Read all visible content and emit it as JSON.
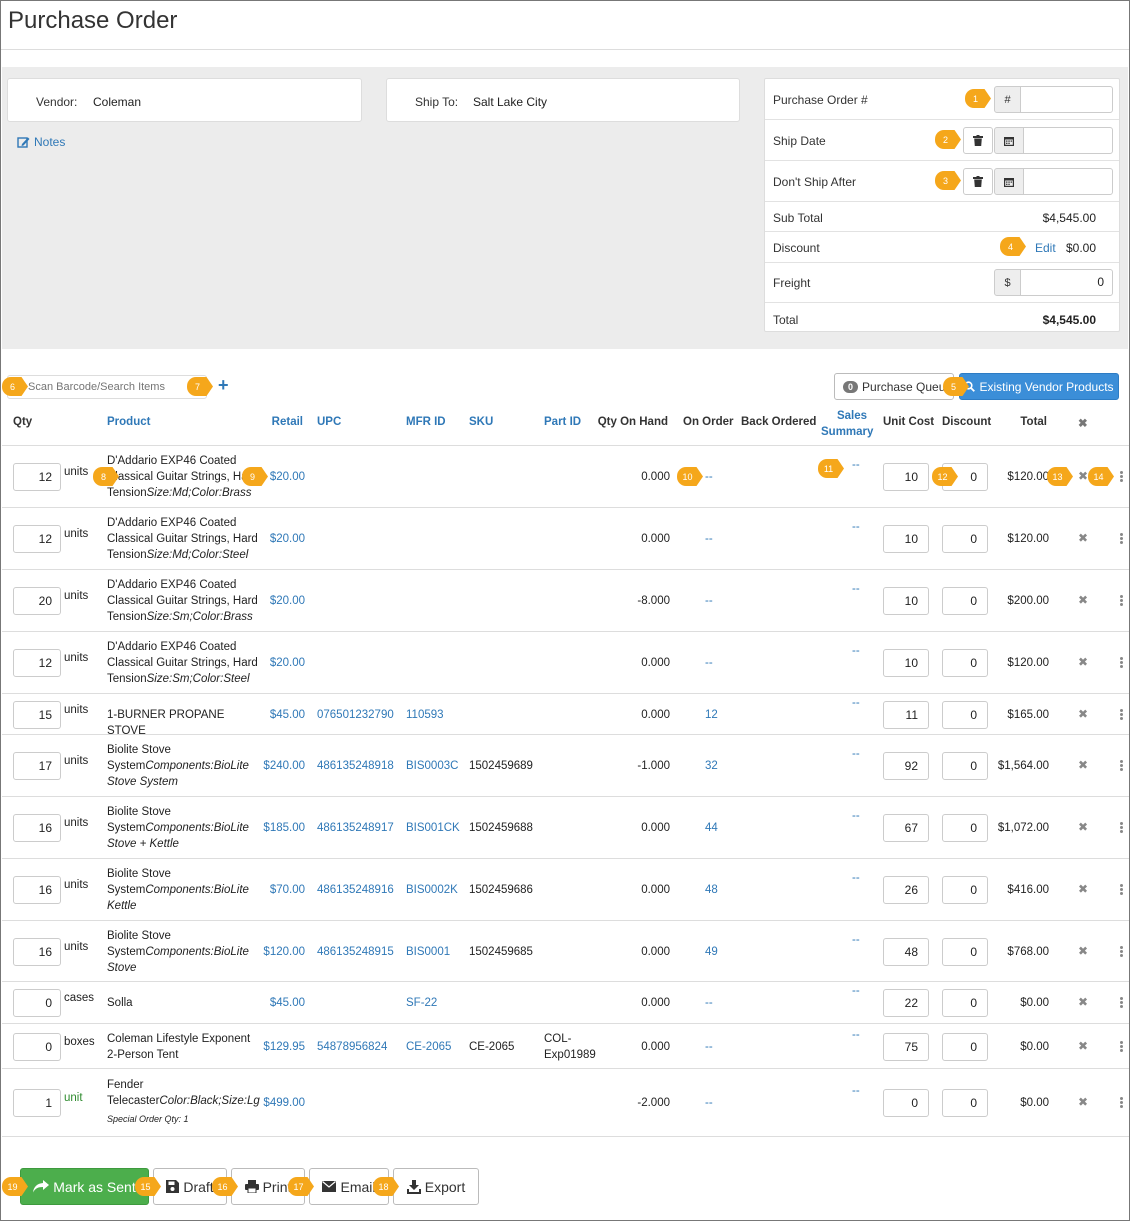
{
  "page_title": "Purchase Order",
  "vendor": {
    "label": "Vendor:",
    "value": "Coleman"
  },
  "ship_to": {
    "label": "Ship To:",
    "value": "Salt Lake City"
  },
  "notes_label": "Notes",
  "summary": {
    "po_label": "Purchase Order #",
    "po_addon": "#",
    "po_value": "",
    "ship_date_label": "Ship Date",
    "ship_date_value": "",
    "dont_ship_label": "Don't Ship After",
    "dont_ship_value": "",
    "subtotal_label": "Sub Total",
    "subtotal_value": "$4,545.00",
    "discount_label": "Discount",
    "discount_edit": "Edit",
    "discount_value": "$0.00",
    "freight_label": "Freight",
    "freight_addon": "$",
    "freight_value": "0",
    "total_label": "Total",
    "total_value": "$4,545.00"
  },
  "search": {
    "placeholder": "Scan Barcode/Search Items",
    "add": "+"
  },
  "queue": {
    "count": "0",
    "label": "Purchase Queue"
  },
  "existing_vendor_label": "Existing Vendor Products",
  "columns": {
    "qty": "Qty",
    "product": "Product",
    "retail": "Retail",
    "upc": "UPC",
    "mfr": "MFR ID",
    "sku": "SKU",
    "part": "Part ID",
    "onhand": "Qty On Hand",
    "onorder": "On Order",
    "backordered": "Back Ordered",
    "sales1": "Sales",
    "sales2": "Summary",
    "unitcost": "Unit Cost",
    "discount": "Discount",
    "total": "Total",
    "remove": "✖"
  },
  "rows": [
    {
      "qty": "12",
      "unit": "units",
      "name": "D'Addario EXP46 Coated Classical Guitar Strings, Hard Tension",
      "variant": "Size:Md;Color:Brass",
      "retail": "$20.00",
      "upc": "",
      "mfr": "",
      "sku": "",
      "part": "",
      "onhand": "0.000",
      "onorder": "--",
      "sales": "--",
      "cost": "10",
      "disc": "0",
      "total": "$120.00"
    },
    {
      "qty": "12",
      "unit": "units",
      "name": "D'Addario EXP46 Coated Classical Guitar Strings, Hard Tension",
      "variant": "Size:Md;Color:Steel",
      "retail": "$20.00",
      "upc": "",
      "mfr": "",
      "sku": "",
      "part": "",
      "onhand": "0.000",
      "onorder": "--",
      "sales": "--",
      "cost": "10",
      "disc": "0",
      "total": "$120.00"
    },
    {
      "qty": "20",
      "unit": "units",
      "name": "D'Addario EXP46 Coated Classical Guitar Strings, Hard Tension",
      "variant": "Size:Sm;Color:Brass",
      "retail": "$20.00",
      "upc": "",
      "mfr": "",
      "sku": "",
      "part": "",
      "onhand": "-8.000",
      "onorder": "--",
      "sales": "--",
      "cost": "10",
      "disc": "0",
      "total": "$200.00"
    },
    {
      "qty": "12",
      "unit": "units",
      "name": "D'Addario EXP46 Coated Classical Guitar Strings, Hard Tension",
      "variant": "Size:Sm;Color:Steel",
      "retail": "$20.00",
      "upc": "",
      "mfr": "",
      "sku": "",
      "part": "",
      "onhand": "0.000",
      "onorder": "--",
      "sales": "--",
      "cost": "10",
      "disc": "0",
      "total": "$120.00"
    },
    {
      "qty": "15",
      "unit": "units",
      "name": "1-BURNER PROPANE STOVE",
      "variant": "",
      "retail": "$45.00",
      "upc": "076501232790",
      "mfr": "110593",
      "sku": "",
      "part": "",
      "onhand": "0.000",
      "onorder": "12",
      "sales": "--",
      "cost": "11",
      "disc": "0",
      "total": "$165.00"
    },
    {
      "qty": "17",
      "unit": "units",
      "name": "Biolite Stove System",
      "variant": "Components:BioLite Stove System",
      "retail": "$240.00",
      "upc": "486135248918",
      "mfr": "BIS0003C",
      "sku": "1502459689",
      "part": "",
      "onhand": "-1.000",
      "onorder": "32",
      "sales": "--",
      "cost": "92",
      "disc": "0",
      "total": "$1,564.00"
    },
    {
      "qty": "16",
      "unit": "units",
      "name": "Biolite Stove System",
      "variant": "Components:BioLite Stove + Kettle",
      "retail": "$185.00",
      "upc": "486135248917",
      "mfr": "BIS001CK",
      "sku": "1502459688",
      "part": "",
      "onhand": "0.000",
      "onorder": "44",
      "sales": "--",
      "cost": "67",
      "disc": "0",
      "total": "$1,072.00"
    },
    {
      "qty": "16",
      "unit": "units",
      "name": "Biolite Stove System",
      "variant": "Components:BioLite Kettle",
      "retail": "$70.00",
      "upc": "486135248916",
      "mfr": "BIS0002K",
      "sku": "1502459686",
      "part": "",
      "onhand": "0.000",
      "onorder": "48",
      "sales": "--",
      "cost": "26",
      "disc": "0",
      "total": "$416.00"
    },
    {
      "qty": "16",
      "unit": "units",
      "name": "Biolite Stove System",
      "variant": "Components:BioLite Stove",
      "retail": "$120.00",
      "upc": "486135248915",
      "mfr": "BIS0001",
      "sku": "1502459685",
      "part": "",
      "onhand": "0.000",
      "onorder": "49",
      "sales": "--",
      "cost": "48",
      "disc": "0",
      "total": "$768.00"
    },
    {
      "qty": "0",
      "unit": "cases",
      "name": "Solla",
      "variant": "",
      "retail": "$45.00",
      "upc": "",
      "mfr": "SF-22",
      "sku": "",
      "part": "",
      "onhand": "0.000",
      "onorder": "--",
      "sales": "--",
      "cost": "22",
      "disc": "0",
      "total": "$0.00"
    },
    {
      "qty": "0",
      "unit": "boxes",
      "name": "Coleman Lifestyle Exponent 2-Person Tent",
      "variant": "",
      "retail": "$129.95",
      "upc": "54878956824",
      "mfr": "CE-2065",
      "sku": "CE-2065",
      "part": "COL-Exp01989",
      "onhand": "0.000",
      "onorder": "--",
      "sales": "--",
      "cost": "75",
      "disc": "0",
      "total": "$0.00"
    },
    {
      "qty": "1",
      "unit": "unit",
      "name": "Fender Telecaster",
      "variant": "Color:Black;Size:Lg",
      "note": "Special Order Qty: 1",
      "retail": "$499.00",
      "upc": "",
      "mfr": "",
      "sku": "",
      "part": "",
      "onhand": "-2.000",
      "onorder": "--",
      "sales": "--",
      "cost": "0",
      "disc": "0",
      "total": "$0.00"
    }
  ],
  "buttons": {
    "mark_sent": "Mark as Sent",
    "draft": "Draft",
    "print": "Print",
    "email": "Email",
    "export": "Export"
  },
  "markers": [
    "1",
    "2",
    "3",
    "4",
    "5",
    "6",
    "7",
    "8",
    "9",
    "10",
    "11",
    "12",
    "13",
    "14",
    "15",
    "16",
    "17",
    "18",
    "19"
  ],
  "colors": {
    "accent": "#2f78b7",
    "primary_button": "#3b8ed8",
    "success": "#4cae4c",
    "marker": "#f5a71b"
  }
}
